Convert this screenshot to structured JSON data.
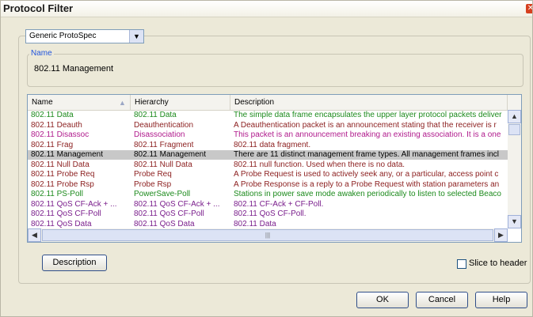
{
  "window": {
    "title": "Protocol Filter"
  },
  "filter": {
    "dropdown_value": "Generic ProtoSpec",
    "name_legend": "Name",
    "name_value": "802.11 Management"
  },
  "table": {
    "columns": [
      "Name",
      "Hierarchy",
      "Description"
    ],
    "rows": [
      {
        "name": "802.11 Data",
        "hierarchy": "802.11 Data",
        "description": "The simple data frame encapsulates the upper layer protocol packets deliver",
        "color": "#1c8a1c",
        "selected": false
      },
      {
        "name": "802.11 Deauth",
        "hierarchy": "Deauthentication",
        "description": "A Deauthentication packet is an announcement stating that the receiver is r",
        "color": "#8b1e1e",
        "selected": false
      },
      {
        "name": "802.11 Disassoc",
        "hierarchy": "Disassociation",
        "description": "This packet is an announcement breaking an existing association. It is a one",
        "color": "#b01a8c",
        "selected": false
      },
      {
        "name": "802.11 Frag",
        "hierarchy": "802.11 Fragment",
        "description": "802.11 data fragment.",
        "color": "#8b1e1e",
        "selected": false
      },
      {
        "name": "802.11 Management",
        "hierarchy": "802.11 Management",
        "description": "There are 11 distinct management frame types. All management frames incl",
        "color": "#000000",
        "selected": true
      },
      {
        "name": "802.11 Null Data",
        "hierarchy": "802.11 Null Data",
        "description": "802.11 null function. Used when there is no data.",
        "color": "#8b1e1e",
        "selected": false
      },
      {
        "name": "802.11 Probe Req",
        "hierarchy": "Probe Req",
        "description": "A Probe Request is used to actively seek any, or a particular, access point c",
        "color": "#8b1e1e",
        "selected": false
      },
      {
        "name": "802.11 Probe Rsp",
        "hierarchy": "Probe Rsp",
        "description": "A Probe Response is a reply to a Probe Request with station parameters an",
        "color": "#8b1e1e",
        "selected": false
      },
      {
        "name": "802.11 PS-Poll",
        "hierarchy": "PowerSave-Poll",
        "description": "Stations in power save mode awaken periodically to listen to selected Beaco",
        "color": "#1c8a1c",
        "selected": false
      },
      {
        "name": "802.11 QoS CF-Ack + ...",
        "hierarchy": "802.11 QoS CF-Ack + ...",
        "description": "802.11 CF-Ack + CF-Poll.",
        "color": "#7a1e8c",
        "selected": false
      },
      {
        "name": "802.11 QoS CF-Poll",
        "hierarchy": "802.11 QoS CF-Poll",
        "description": "802.11 QoS CF-Poll.",
        "color": "#7a1e8c",
        "selected": false
      },
      {
        "name": "802.11 QoS Data",
        "hierarchy": "802.11 QoS Data",
        "description": "802.11 Data",
        "color": "#7a1e8c",
        "selected": false
      }
    ]
  },
  "buttons": {
    "description": "Description",
    "ok": "OK",
    "cancel": "Cancel",
    "help": "Help"
  },
  "checkbox": {
    "label": "Slice to header",
    "checked": false
  },
  "icons": {
    "close": "close-icon",
    "dropdown": "chevron-down-icon",
    "sort": "sort-ascending-icon",
    "scroll_up": "arrow-up-icon",
    "scroll_down": "arrow-down-icon",
    "scroll_left": "arrow-left-icon",
    "scroll_right": "arrow-right-icon",
    "grip": "scroll-grip-icon"
  }
}
